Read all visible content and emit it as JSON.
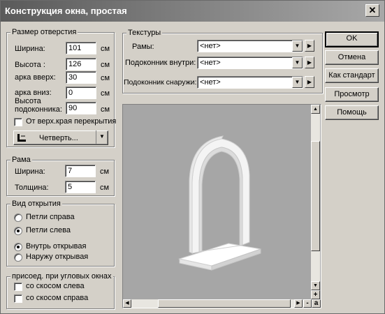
{
  "window": {
    "title": "Конструкция окна, простая",
    "close_glyph": "✕"
  },
  "opening": {
    "legend": "Размер отверстия",
    "width_label": "Ширина:",
    "width_value": "101",
    "width_unit": "см",
    "height_label": "Высота :",
    "height_value": "126",
    "height_unit": "см",
    "arch_up_label": "арка вверх:",
    "arch_up_value": "30",
    "arch_up_unit": "см",
    "arch_down_label": "арка вниз:",
    "arch_down_value": "0",
    "arch_down_unit": "см",
    "sill_label_1": "Высота",
    "sill_label_2": "подоконника:",
    "sill_value": "90",
    "sill_unit": "см",
    "from_top_label": "От верх.края перекрытия",
    "shape_button": "Четверть..."
  },
  "frame": {
    "legend": "Рама",
    "width_label": "Ширина:",
    "width_value": "7",
    "width_unit": "см",
    "thickness_label": "Толщина:",
    "thickness_value": "5",
    "thickness_unit": "см"
  },
  "opening_type": {
    "legend": "Вид открытия",
    "hinges_right": "Петли справа",
    "hinges_left": "Петли слева",
    "hinges_selected": "left",
    "inward": "Внутрь открывая",
    "outward": "Наружу открывая",
    "direction_selected": "inward"
  },
  "corner": {
    "legend": "присоед. при угловых окнах",
    "bevel_left": "со скосом слева",
    "bevel_right": "со скосом справа"
  },
  "textures": {
    "legend": "Текстуры",
    "frames_label": "Рамы:",
    "frames_value": "<нет>",
    "sill_in_label": "Подоконник внутри:",
    "sill_in_value": "<нет>",
    "sill_out_label": "Подоконник снаружи:",
    "sill_out_value": "<нет>"
  },
  "buttons": {
    "ok": "OK",
    "cancel": "Отмена",
    "as_standard": "Как стандарт",
    "preview": "Просмотр",
    "help": "Помощь"
  },
  "preview_controls": {
    "zoom_in": "+",
    "zoom_out": "-",
    "auto": "a"
  },
  "colors": {
    "preview_bg": "#a6a6a6",
    "dialog_bg": "#d4d0c8"
  }
}
